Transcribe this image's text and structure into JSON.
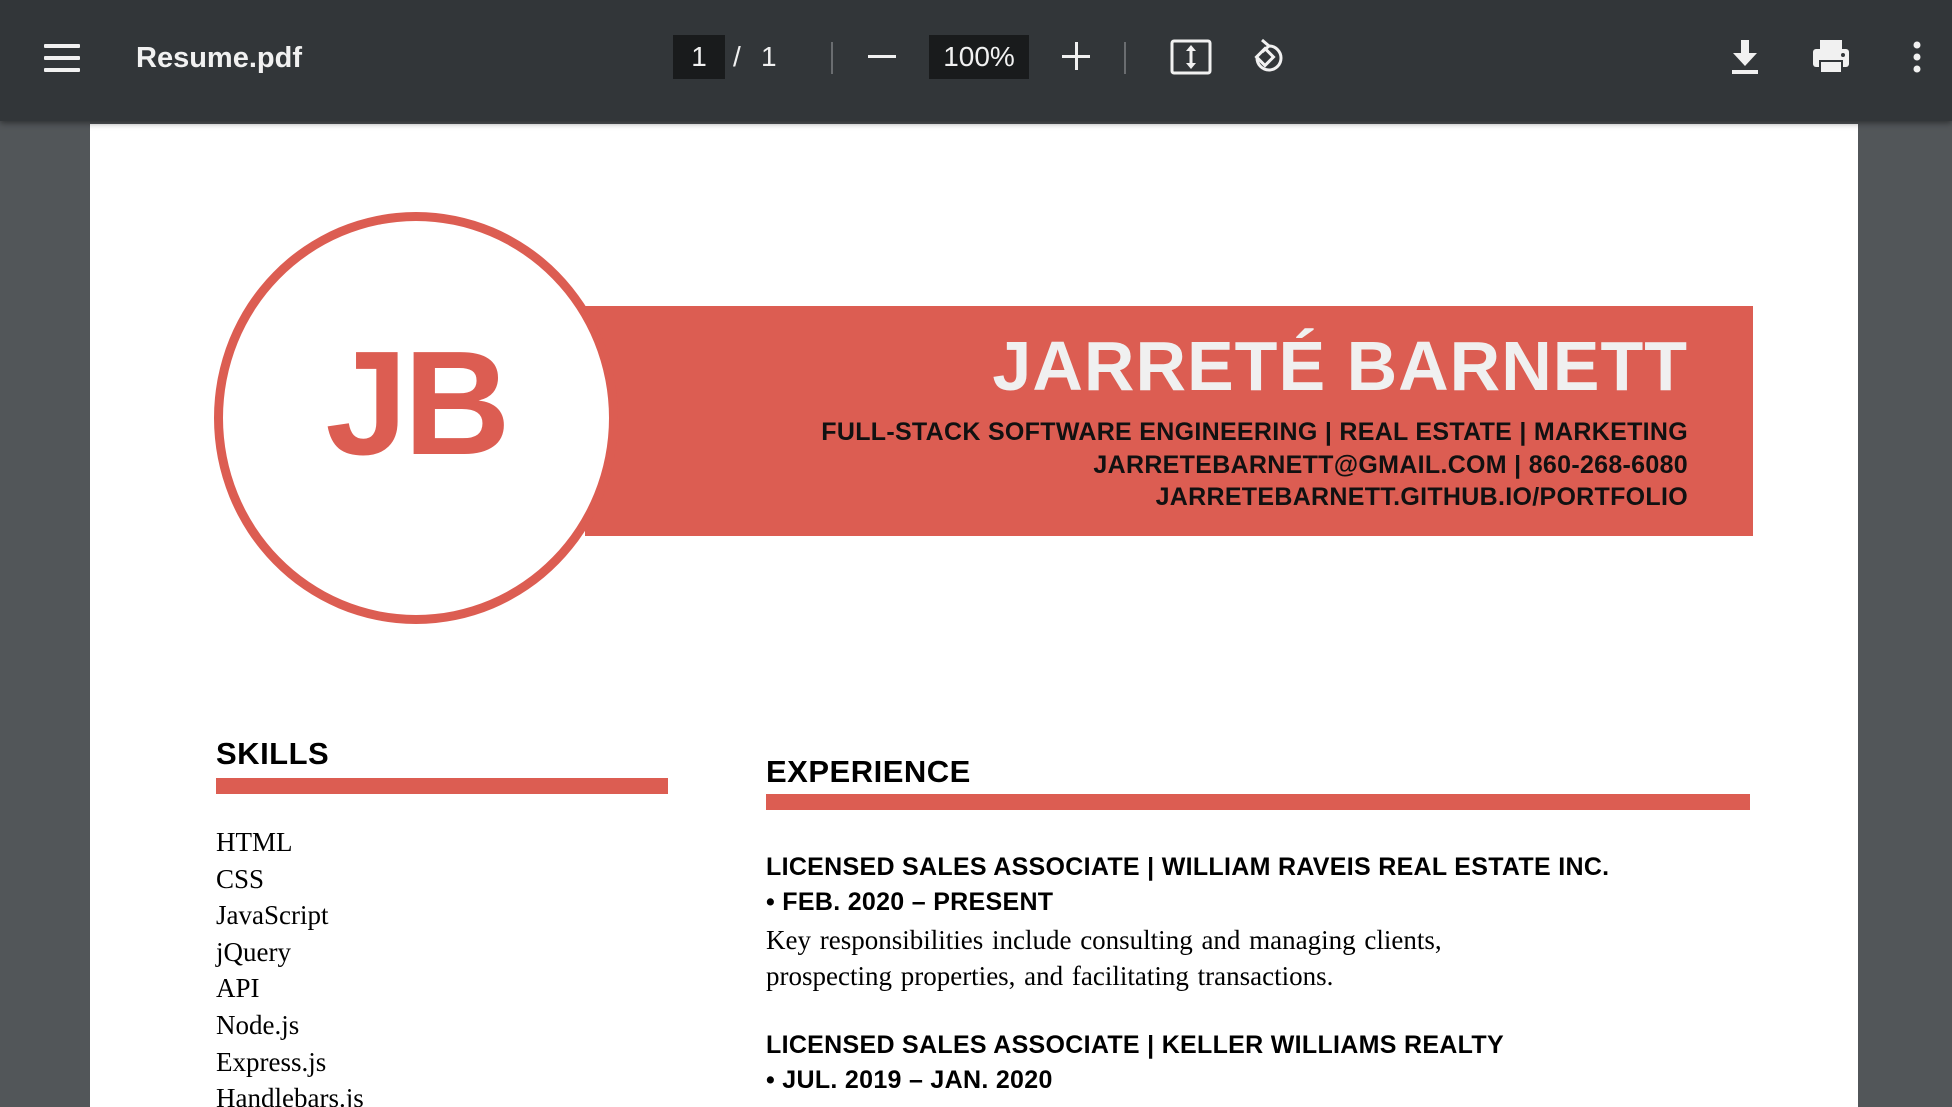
{
  "toolbar": {
    "file_name": "Resume.pdf",
    "current_page": "1",
    "page_separator": "/",
    "total_pages": "1",
    "zoom": "100%",
    "icons": [
      "menu-icon",
      "zoom-out-icon",
      "zoom-in-icon",
      "fit-page-icon",
      "rotate-icon",
      "download-icon",
      "print-icon",
      "more-vert-icon"
    ]
  },
  "resume": {
    "initials": "JB",
    "name": "JARRETÉ BARNETT",
    "tagline": "FULL-STACK SOFTWARE ENGINEERING  | REAL ESTATE  | MARKETING",
    "contact": "JARRETEBARNETT@GMAIL.COM   | 860-268-6080",
    "portfolio": "JARRETEBARNETT.GITHUB.IO/PORTFOLIO",
    "skills_heading": "SKILLS",
    "skills": [
      "HTML",
      "CSS",
      "JavaScript",
      "jQuery",
      "API",
      "Node.js",
      "Express.js",
      "Handlebars.js"
    ],
    "experience_heading": "EXPERIENCE",
    "jobs": [
      {
        "title": "LICENSED SALES ASSOCIATE  | WILLIAM RAVEIS REAL ESTATE INC.",
        "dates": "• FEB. 2020 – PRESENT",
        "description_line1": "Key responsibilities include consulting and managing clients,",
        "description_line2": "prospecting properties, and facilitating transactions."
      },
      {
        "title": "LICENSED SALES ASSOCIATE  | KELLER WILLIAMS REALTY",
        "dates": "• JUL. 2019 – JAN. 2020"
      }
    ]
  },
  "colors": {
    "toolbar_bg": "#323639",
    "viewer_bg": "#525659",
    "accent": "#dc5d52",
    "name_text": "#f0f0f0"
  }
}
